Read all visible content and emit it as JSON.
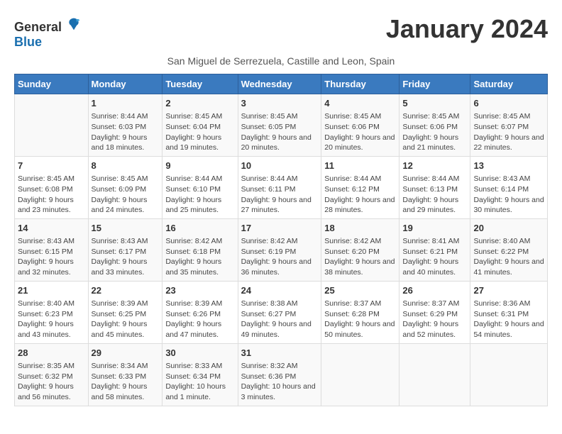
{
  "header": {
    "logo_general": "General",
    "logo_blue": "Blue",
    "title": "January 2024",
    "subtitle": "San Miguel de Serrezuela, Castille and Leon, Spain"
  },
  "calendar": {
    "days_of_week": [
      "Sunday",
      "Monday",
      "Tuesday",
      "Wednesday",
      "Thursday",
      "Friday",
      "Saturday"
    ],
    "weeks": [
      [
        {
          "day": "",
          "sunrise": "",
          "sunset": "",
          "daylight": ""
        },
        {
          "day": "1",
          "sunrise": "Sunrise: 8:44 AM",
          "sunset": "Sunset: 6:03 PM",
          "daylight": "Daylight: 9 hours and 18 minutes."
        },
        {
          "day": "2",
          "sunrise": "Sunrise: 8:45 AM",
          "sunset": "Sunset: 6:04 PM",
          "daylight": "Daylight: 9 hours and 19 minutes."
        },
        {
          "day": "3",
          "sunrise": "Sunrise: 8:45 AM",
          "sunset": "Sunset: 6:05 PM",
          "daylight": "Daylight: 9 hours and 20 minutes."
        },
        {
          "day": "4",
          "sunrise": "Sunrise: 8:45 AM",
          "sunset": "Sunset: 6:06 PM",
          "daylight": "Daylight: 9 hours and 20 minutes."
        },
        {
          "day": "5",
          "sunrise": "Sunrise: 8:45 AM",
          "sunset": "Sunset: 6:06 PM",
          "daylight": "Daylight: 9 hours and 21 minutes."
        },
        {
          "day": "6",
          "sunrise": "Sunrise: 8:45 AM",
          "sunset": "Sunset: 6:07 PM",
          "daylight": "Daylight: 9 hours and 22 minutes."
        }
      ],
      [
        {
          "day": "7",
          "sunrise": "Sunrise: 8:45 AM",
          "sunset": "Sunset: 6:08 PM",
          "daylight": "Daylight: 9 hours and 23 minutes."
        },
        {
          "day": "8",
          "sunrise": "Sunrise: 8:45 AM",
          "sunset": "Sunset: 6:09 PM",
          "daylight": "Daylight: 9 hours and 24 minutes."
        },
        {
          "day": "9",
          "sunrise": "Sunrise: 8:44 AM",
          "sunset": "Sunset: 6:10 PM",
          "daylight": "Daylight: 9 hours and 25 minutes."
        },
        {
          "day": "10",
          "sunrise": "Sunrise: 8:44 AM",
          "sunset": "Sunset: 6:11 PM",
          "daylight": "Daylight: 9 hours and 27 minutes."
        },
        {
          "day": "11",
          "sunrise": "Sunrise: 8:44 AM",
          "sunset": "Sunset: 6:12 PM",
          "daylight": "Daylight: 9 hours and 28 minutes."
        },
        {
          "day": "12",
          "sunrise": "Sunrise: 8:44 AM",
          "sunset": "Sunset: 6:13 PM",
          "daylight": "Daylight: 9 hours and 29 minutes."
        },
        {
          "day": "13",
          "sunrise": "Sunrise: 8:43 AM",
          "sunset": "Sunset: 6:14 PM",
          "daylight": "Daylight: 9 hours and 30 minutes."
        }
      ],
      [
        {
          "day": "14",
          "sunrise": "Sunrise: 8:43 AM",
          "sunset": "Sunset: 6:15 PM",
          "daylight": "Daylight: 9 hours and 32 minutes."
        },
        {
          "day": "15",
          "sunrise": "Sunrise: 8:43 AM",
          "sunset": "Sunset: 6:17 PM",
          "daylight": "Daylight: 9 hours and 33 minutes."
        },
        {
          "day": "16",
          "sunrise": "Sunrise: 8:42 AM",
          "sunset": "Sunset: 6:18 PM",
          "daylight": "Daylight: 9 hours and 35 minutes."
        },
        {
          "day": "17",
          "sunrise": "Sunrise: 8:42 AM",
          "sunset": "Sunset: 6:19 PM",
          "daylight": "Daylight: 9 hours and 36 minutes."
        },
        {
          "day": "18",
          "sunrise": "Sunrise: 8:42 AM",
          "sunset": "Sunset: 6:20 PM",
          "daylight": "Daylight: 9 hours and 38 minutes."
        },
        {
          "day": "19",
          "sunrise": "Sunrise: 8:41 AM",
          "sunset": "Sunset: 6:21 PM",
          "daylight": "Daylight: 9 hours and 40 minutes."
        },
        {
          "day": "20",
          "sunrise": "Sunrise: 8:40 AM",
          "sunset": "Sunset: 6:22 PM",
          "daylight": "Daylight: 9 hours and 41 minutes."
        }
      ],
      [
        {
          "day": "21",
          "sunrise": "Sunrise: 8:40 AM",
          "sunset": "Sunset: 6:23 PM",
          "daylight": "Daylight: 9 hours and 43 minutes."
        },
        {
          "day": "22",
          "sunrise": "Sunrise: 8:39 AM",
          "sunset": "Sunset: 6:25 PM",
          "daylight": "Daylight: 9 hours and 45 minutes."
        },
        {
          "day": "23",
          "sunrise": "Sunrise: 8:39 AM",
          "sunset": "Sunset: 6:26 PM",
          "daylight": "Daylight: 9 hours and 47 minutes."
        },
        {
          "day": "24",
          "sunrise": "Sunrise: 8:38 AM",
          "sunset": "Sunset: 6:27 PM",
          "daylight": "Daylight: 9 hours and 49 minutes."
        },
        {
          "day": "25",
          "sunrise": "Sunrise: 8:37 AM",
          "sunset": "Sunset: 6:28 PM",
          "daylight": "Daylight: 9 hours and 50 minutes."
        },
        {
          "day": "26",
          "sunrise": "Sunrise: 8:37 AM",
          "sunset": "Sunset: 6:29 PM",
          "daylight": "Daylight: 9 hours and 52 minutes."
        },
        {
          "day": "27",
          "sunrise": "Sunrise: 8:36 AM",
          "sunset": "Sunset: 6:31 PM",
          "daylight": "Daylight: 9 hours and 54 minutes."
        }
      ],
      [
        {
          "day": "28",
          "sunrise": "Sunrise: 8:35 AM",
          "sunset": "Sunset: 6:32 PM",
          "daylight": "Daylight: 9 hours and 56 minutes."
        },
        {
          "day": "29",
          "sunrise": "Sunrise: 8:34 AM",
          "sunset": "Sunset: 6:33 PM",
          "daylight": "Daylight: 9 hours and 58 minutes."
        },
        {
          "day": "30",
          "sunrise": "Sunrise: 8:33 AM",
          "sunset": "Sunset: 6:34 PM",
          "daylight": "Daylight: 10 hours and 1 minute."
        },
        {
          "day": "31",
          "sunrise": "Sunrise: 8:32 AM",
          "sunset": "Sunset: 6:36 PM",
          "daylight": "Daylight: 10 hours and 3 minutes."
        },
        {
          "day": "",
          "sunrise": "",
          "sunset": "",
          "daylight": ""
        },
        {
          "day": "",
          "sunrise": "",
          "sunset": "",
          "daylight": ""
        },
        {
          "day": "",
          "sunrise": "",
          "sunset": "",
          "daylight": ""
        }
      ]
    ]
  }
}
